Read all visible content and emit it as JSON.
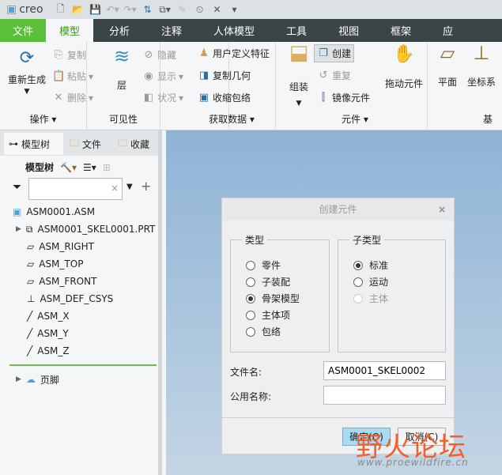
{
  "app": {
    "logo": "creo"
  },
  "tabs": [
    "文件",
    "模型",
    "分析",
    "注释",
    "人体模型",
    "工具",
    "视图",
    "框架",
    "应"
  ],
  "ribbon": {
    "ops": {
      "regen": "重新生成",
      "copy": "复制",
      "paste": "粘贴",
      "delete": "删除",
      "label": "操作"
    },
    "vis": {
      "layer": "层",
      "hide": "隐藏",
      "show": "显示",
      "status": "状况",
      "label": "可见性"
    },
    "data": {
      "udf": "用户定义特征",
      "copygeom": "复制几何",
      "shrinkwrap": "收缩包络",
      "label": "获取数据"
    },
    "comp": {
      "assemble": "组装",
      "create": "创建",
      "repeat": "重复",
      "mirror": "镜像元件",
      "drag": "拖动元件",
      "label": "元件"
    },
    "datum": {
      "plane": "平面",
      "csys": "坐标系",
      "label": "基"
    }
  },
  "left": {
    "tabs": [
      "模型树",
      "文件",
      "收藏"
    ],
    "toolbar_label": "模型树",
    "search_value": "",
    "tree": [
      "ASM0001.ASM",
      "ASM0001_SKEL0001.PRT",
      "ASM_RIGHT",
      "ASM_TOP",
      "ASM_FRONT",
      "ASM_DEF_CSYS",
      "ASM_X",
      "ASM_Y",
      "ASM_Z"
    ],
    "footer": "页脚"
  },
  "dialog": {
    "title": "创建元件",
    "type_label": "类型",
    "types": [
      "零件",
      "子装配",
      "骨架模型",
      "主体项",
      "包络"
    ],
    "type_selected": 2,
    "subtype_label": "子类型",
    "subtypes": [
      "标准",
      "运动",
      "主体"
    ],
    "filename_label": "文件名:",
    "filename": "ASM0001_SKEL0002",
    "common_label": "公用名称:",
    "common": "",
    "ok": "确定(O)",
    "cancel": "取消(C)"
  },
  "watermark": {
    "text": "野火论坛",
    "url": "www.proewildfire.cn"
  }
}
